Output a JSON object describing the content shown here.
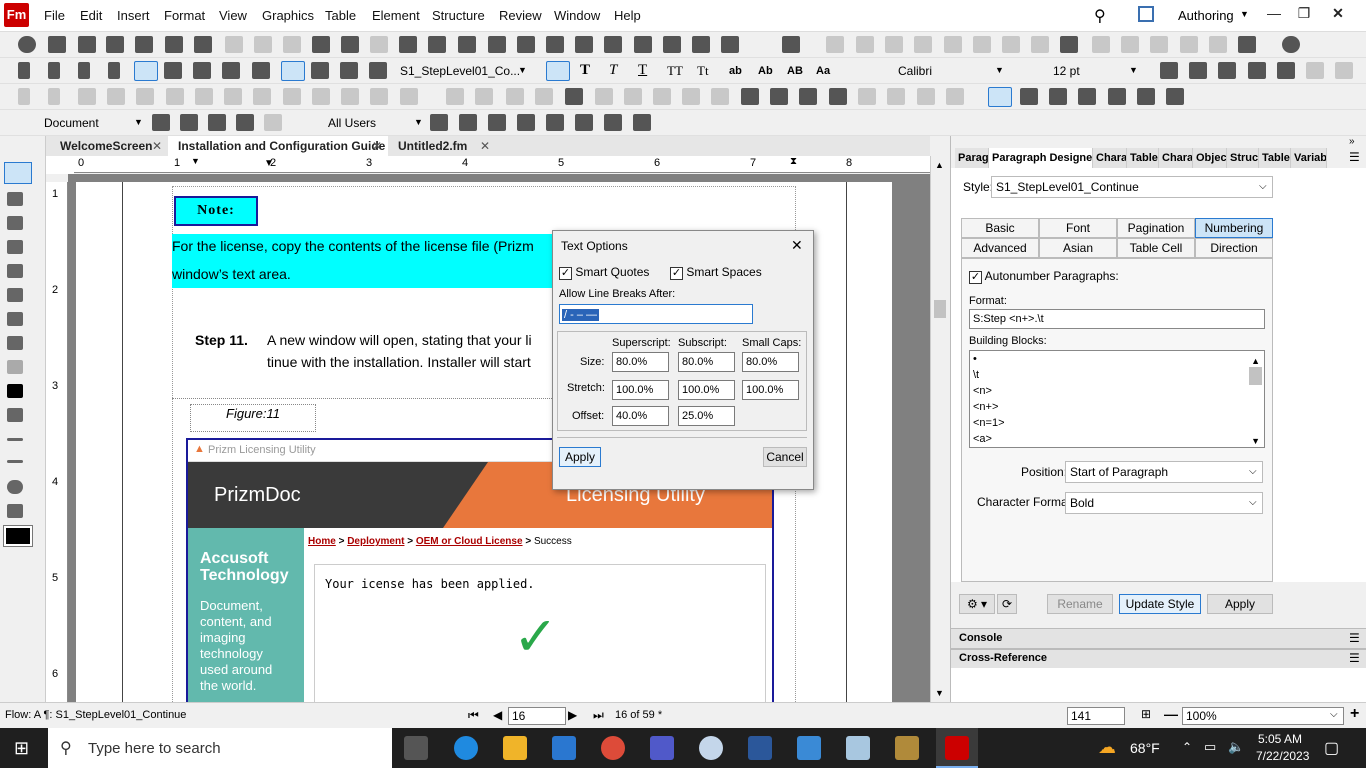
{
  "app": {
    "logo": "Fm"
  },
  "menu": [
    "File",
    "Edit",
    "Insert",
    "Format",
    "View",
    "Graphics",
    "Table",
    "Element",
    "Structure",
    "Review",
    "Window",
    "Help"
  ],
  "workspace": "Authoring",
  "toolbar_format": {
    "paragraph_tag": "S1_StepLevel01_Co...",
    "font": "Calibri",
    "size": "12 pt"
  },
  "toolbar_view": {
    "view_mode": "Document",
    "condition": "All Users"
  },
  "doc_tabs": [
    "WelcomeScreen",
    "Installation and Configuration Guide",
    "Untitled2.fm"
  ],
  "ruler": [
    "0",
    "1",
    "2",
    "3",
    "4",
    "5",
    "6",
    "7",
    "8"
  ],
  "vruler": [
    "1",
    "2",
    "3",
    "4",
    "5",
    "6"
  ],
  "document": {
    "note_label": "Note:",
    "note_line1": "For the license, copy the contents of the license file (Prizm",
    "note_line2": "window’s text area.",
    "step_label": "Step 11.",
    "step_line1": "A new window will open, stating that your li",
    "step_line2": "tinue with the installation. Installer will start",
    "figure_caption": "Figure:11",
    "shot": {
      "titlebar": "Prizm Licensing Utility",
      "brand": "PrizmDoc",
      "banner_title": "Licensing Utility",
      "company": "Accusoft Technology",
      "tagline": "Document, content, and imaging technology used around the world.",
      "crumb_home": "Home",
      "crumb_sep": ">",
      "crumb_deployment": "Deployment",
      "crumb_oem": "OEM or Cloud License",
      "crumb_success": "Success",
      "message": "Your icense has been applied.",
      "check": "✓"
    }
  },
  "dialog": {
    "title": "Text Options",
    "close": "✕",
    "smart_quotes": "Smart Quotes",
    "smart_spaces": "Smart Spaces",
    "line_breaks_label": "Allow Line Breaks After:",
    "line_breaks_value": "/ - – —",
    "cols": [
      "Superscript:",
      "Subscript:",
      "Small Caps:"
    ],
    "rows": [
      {
        "label": "Size:",
        "values": [
          "80.0%",
          "80.0%",
          "80.0%"
        ]
      },
      {
        "label": "Stretch:",
        "values": [
          "100.0%",
          "100.0%",
          "100.0%"
        ]
      },
      {
        "label": "Offset:",
        "values": [
          "40.0%",
          "25.0%",
          ""
        ]
      }
    ],
    "apply": "Apply",
    "cancel": "Cancel"
  },
  "panel": {
    "tabs": [
      "Parag",
      "Paragraph Designer",
      "Chara",
      "Table",
      "Chara",
      "Objec",
      "Struc",
      "Table",
      "Variab"
    ],
    "style_label": "Style:",
    "style_value": "S1_StepLevel01_Continue",
    "prop_tabs_row1": [
      "Basic",
      "Font",
      "Pagination",
      "Numbering"
    ],
    "prop_tabs_row2": [
      "Advanced",
      "Asian",
      "Table Cell",
      "Direction"
    ],
    "autonumber_label": "Autonumber Paragraphs:",
    "format_label": "Format:",
    "format_value": "S:Step <n+>.\\t",
    "building_blocks_label": "Building Blocks:",
    "building_blocks": [
      "•",
      "\\t",
      "<n>",
      "<n+>",
      "<n=1>",
      "<a>"
    ],
    "position_label": "Position:",
    "position_value": "Start of Paragraph",
    "charformat_label": "Character Format:",
    "charformat_value": "Bold",
    "rename": "Rename",
    "update_style": "Update Style",
    "apply": "Apply",
    "console": "Console",
    "crossref": "Cross-Reference"
  },
  "status": {
    "flow": "Flow: A  ¶: S1_StepLevel01_Continue",
    "page_input": "16",
    "page_of": "16 of 59 *",
    "zoom_pct_input": "141",
    "zoom": "100%"
  },
  "taskbar": {
    "search_placeholder": "Type here to search",
    "weather": "68°F",
    "time": "5:05 AM",
    "date": "7/22/2023"
  },
  "colors": {
    "accent": "#2a7ad0",
    "note_bg": "#00ffff",
    "banner_orange": "#e8773c",
    "banner_dark": "#3a3a3a",
    "teal": "#62b9ad",
    "brand_red": "#c00000"
  }
}
